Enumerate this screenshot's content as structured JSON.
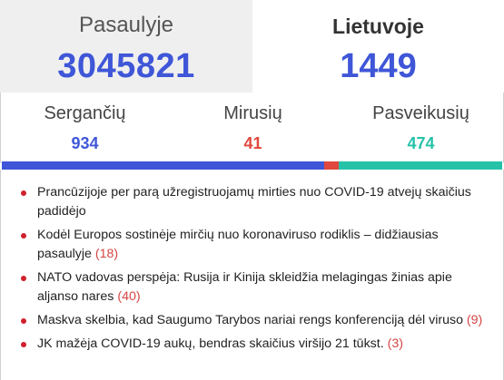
{
  "top": {
    "world": {
      "label": "Pasaulyje",
      "value": "3045821"
    },
    "local": {
      "label": "Lietuvoje",
      "value": "1449"
    }
  },
  "stats": [
    {
      "label": "Sergančių",
      "value": "934",
      "color": "#3f56d8"
    },
    {
      "label": "Mirusių",
      "value": "41",
      "color": "#e0483d"
    },
    {
      "label": "Pasveikusių",
      "value": "474",
      "color": "#25c2a8"
    }
  ],
  "progress": {
    "segments": [
      {
        "name": "sergantys",
        "fraction": 0.645,
        "color": "#3f56d8"
      },
      {
        "name": "mirusieji",
        "fraction": 0.028,
        "color": "#e0483d"
      },
      {
        "name": "pasveike",
        "fraction": 0.327,
        "color": "#25c2a8"
      }
    ]
  },
  "news": [
    {
      "title": "Prancūzijoje per parą užregistruojamų mirties nuo COVID-19 atvejų skaičius padidėjo",
      "count": ""
    },
    {
      "title": "Kodėl Europos sostinėje mirčių nuo koronaviruso rodiklis – didžiausias pasaulyje",
      "count": "(18)"
    },
    {
      "title": "NATO vadovas perspėja: Rusija ir Kinija skleidžia melagingas žinias apie aljanso nares",
      "count": "(40)"
    },
    {
      "title": "Maskva skelbia, kad Saugumo Tarybos nariai rengs konferenciją dėl viruso",
      "count": "(9)"
    },
    {
      "title": "JK mažėja COVID-19 aukų, bendras skaičius viršijo 21 tūkst.",
      "count": "(3)"
    }
  ]
}
